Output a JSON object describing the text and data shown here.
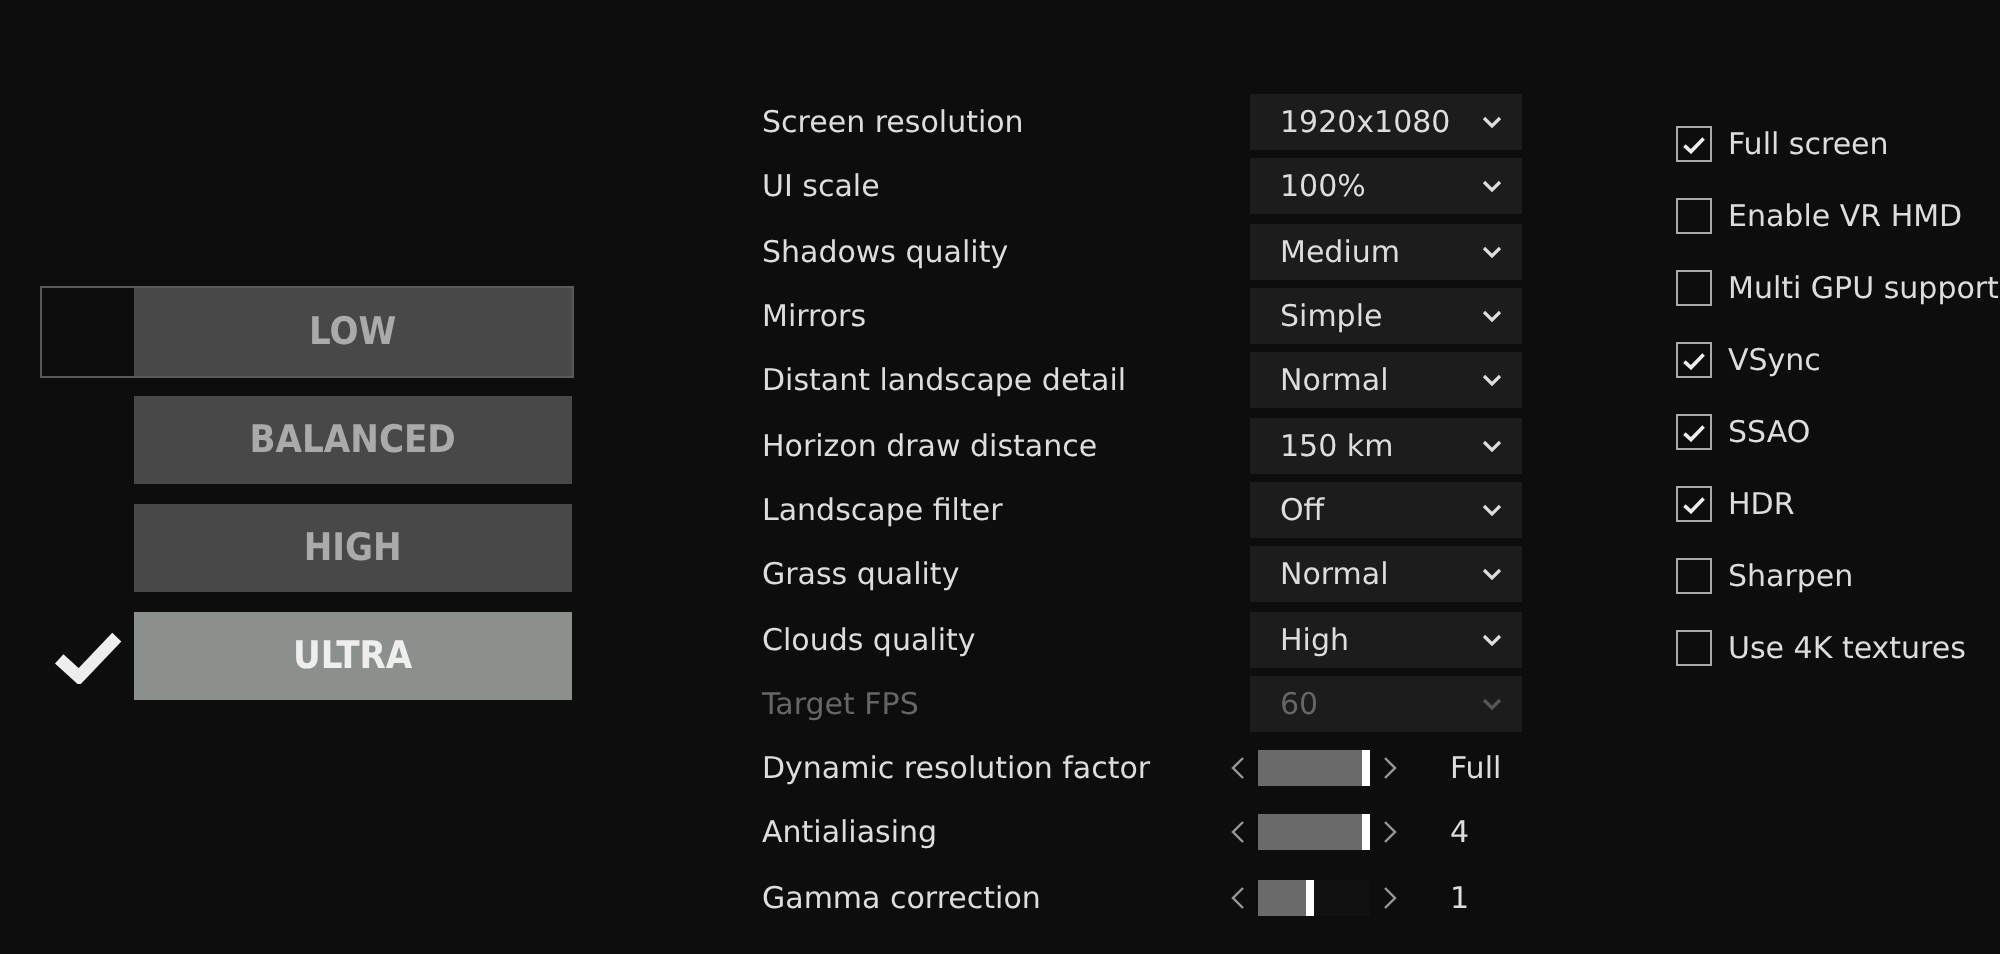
{
  "presets": [
    {
      "label": "LOW",
      "selected": false,
      "hovered": true
    },
    {
      "label": "BALANCED",
      "selected": false,
      "hovered": false
    },
    {
      "label": "HIGH",
      "selected": false,
      "hovered": false
    },
    {
      "label": "ULTRA",
      "selected": true,
      "hovered": false
    }
  ],
  "settings": [
    {
      "kind": "select",
      "label": "Screen resolution",
      "value": "1920x1080",
      "disabled": false
    },
    {
      "kind": "select",
      "label": "UI scale",
      "value": "100%",
      "disabled": false
    },
    {
      "kind": "select",
      "label": "Shadows quality",
      "value": "Medium",
      "disabled": false
    },
    {
      "kind": "select",
      "label": "Mirrors",
      "value": "Simple",
      "disabled": false
    },
    {
      "kind": "select",
      "label": "Distant landscape detail",
      "value": "Normal",
      "disabled": false
    },
    {
      "kind": "select",
      "label": "Horizon draw distance",
      "value": "150 km",
      "disabled": false
    },
    {
      "kind": "select",
      "label": "Landscape filter",
      "value": "Off",
      "disabled": false
    },
    {
      "kind": "select",
      "label": "Grass quality",
      "value": "Normal",
      "disabled": false
    },
    {
      "kind": "select",
      "label": "Clouds quality",
      "value": "High",
      "disabled": false
    },
    {
      "kind": "select",
      "label": "Target FPS",
      "value": "60",
      "disabled": true
    },
    {
      "kind": "slider",
      "label": "Dynamic resolution factor",
      "level": 1.0,
      "reading": "Full"
    },
    {
      "kind": "slider",
      "label": "Antialiasing",
      "level": 1.0,
      "reading": "4"
    },
    {
      "kind": "slider",
      "label": "Gamma correction",
      "level": 0.5,
      "reading": "1"
    }
  ],
  "options": [
    {
      "label": "Full screen",
      "checked": true
    },
    {
      "label": "Enable VR HMD",
      "checked": false
    },
    {
      "label": "Multi GPU support",
      "checked": false
    },
    {
      "label": "VSync",
      "checked": true
    },
    {
      "label": "SSAO",
      "checked": true
    },
    {
      "label": "HDR",
      "checked": true
    },
    {
      "label": "Sharpen",
      "checked": false
    },
    {
      "label": "Use 4K textures",
      "checked": false
    }
  ]
}
